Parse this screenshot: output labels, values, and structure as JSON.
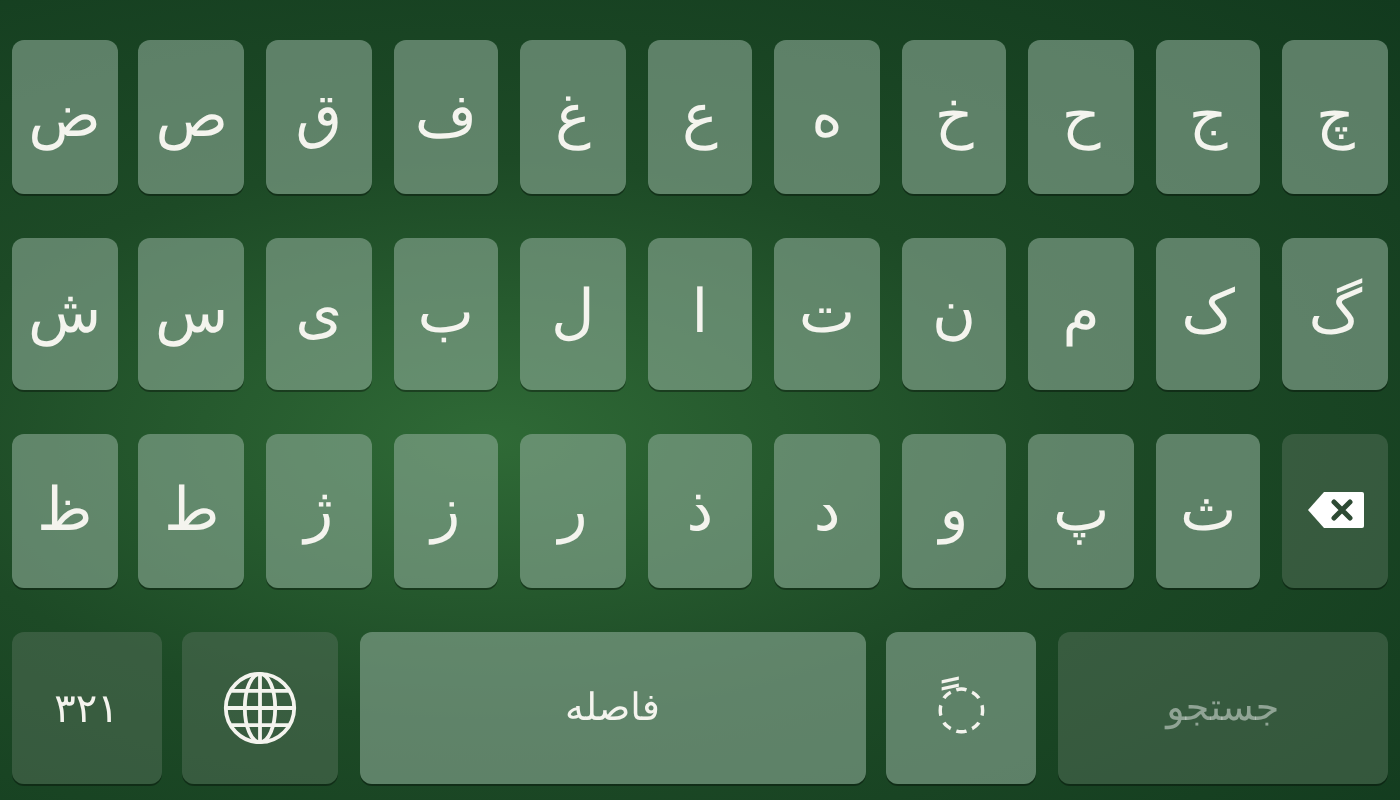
{
  "rows": [
    {
      "keys": [
        {
          "kind": "letter",
          "label": "چ"
        },
        {
          "kind": "letter",
          "label": "ج"
        },
        {
          "kind": "letter",
          "label": "ح"
        },
        {
          "kind": "letter",
          "label": "خ"
        },
        {
          "kind": "letter",
          "label": "ه"
        },
        {
          "kind": "letter",
          "label": "ع"
        },
        {
          "kind": "letter",
          "label": "غ"
        },
        {
          "kind": "letter",
          "label": "ف"
        },
        {
          "kind": "letter",
          "label": "ق"
        },
        {
          "kind": "letter",
          "label": "ص"
        },
        {
          "kind": "letter",
          "label": "ض"
        }
      ]
    },
    {
      "keys": [
        {
          "kind": "letter",
          "label": "گ"
        },
        {
          "kind": "letter",
          "label": "ک"
        },
        {
          "kind": "letter",
          "label": "م"
        },
        {
          "kind": "letter",
          "label": "ن"
        },
        {
          "kind": "letter",
          "label": "ت"
        },
        {
          "kind": "letter",
          "label": "ا"
        },
        {
          "kind": "letter",
          "label": "ل"
        },
        {
          "kind": "letter",
          "label": "ب"
        },
        {
          "kind": "letter",
          "label": "ی"
        },
        {
          "kind": "letter",
          "label": "س"
        },
        {
          "kind": "letter",
          "label": "ش"
        }
      ]
    },
    {
      "keys": [
        {
          "kind": "backspace"
        },
        {
          "kind": "letter",
          "label": "ث"
        },
        {
          "kind": "letter",
          "label": "پ"
        },
        {
          "kind": "letter",
          "label": "و"
        },
        {
          "kind": "letter",
          "label": "د"
        },
        {
          "kind": "letter",
          "label": "ذ"
        },
        {
          "kind": "letter",
          "label": "ر"
        },
        {
          "kind": "letter",
          "label": "ز"
        },
        {
          "kind": "letter",
          "label": "ژ"
        },
        {
          "kind": "letter",
          "label": "ط"
        },
        {
          "kind": "letter",
          "label": "ظ"
        }
      ]
    }
  ],
  "bottom_row": [
    {
      "kind": "search",
      "label": "جستجو",
      "disabled": true
    },
    {
      "kind": "diacritic",
      "label": "◌ً"
    },
    {
      "kind": "space",
      "label": "فاصله"
    },
    {
      "kind": "globe"
    },
    {
      "kind": "numbers",
      "label": "۳۲۱"
    }
  ]
}
